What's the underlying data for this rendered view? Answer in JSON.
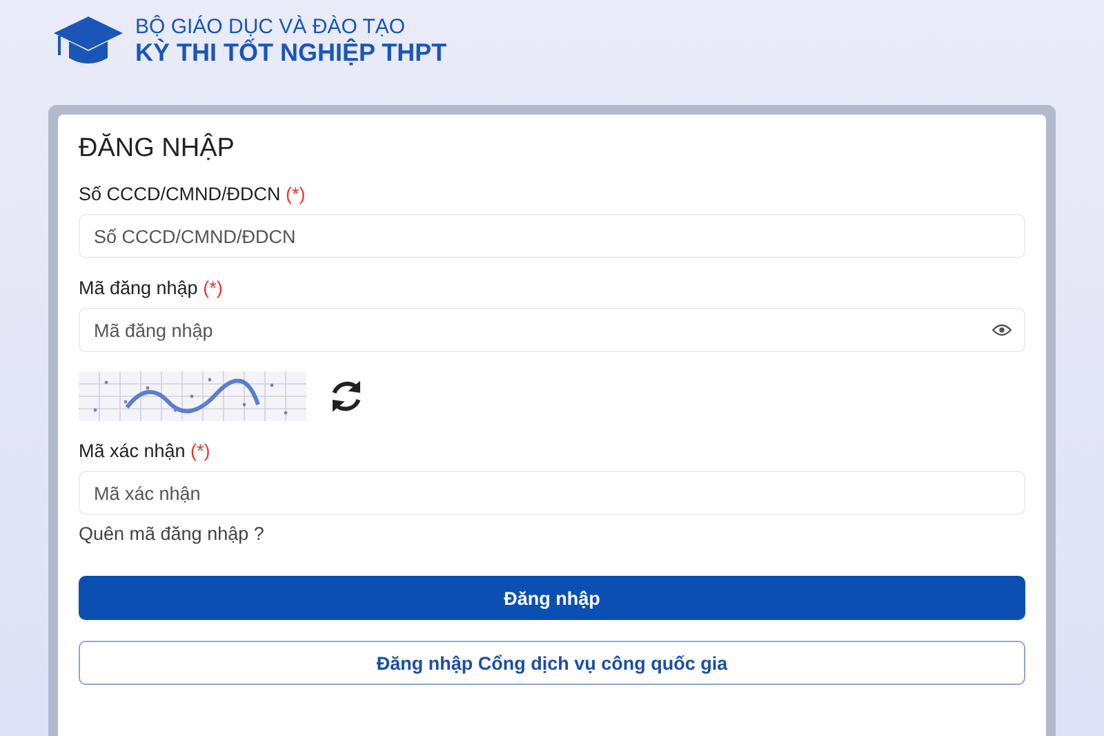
{
  "header": {
    "org": "BỘ GIÁO DỤC VÀ ĐÀO TẠO",
    "title": "KỲ THI TỐT NGHIỆP THPT"
  },
  "form": {
    "title": "ĐĂNG NHẬP",
    "fields": [
      {
        "kind": "text",
        "label": "Số CCCD/CMND/ĐDCN",
        "required_mark": "(*)",
        "placeholder": "Số CCCD/CMND/ĐDCN"
      },
      {
        "kind": "password",
        "label": "Mã đăng nhập",
        "required_mark": "(*)",
        "placeholder": "Mã đăng nhập"
      },
      {
        "kind": "captcha",
        "label": "Mã xác nhận",
        "required_mark": "(*)",
        "placeholder": "Mã xác nhận"
      }
    ],
    "forgot_link": "Quên mã đăng nhập ?",
    "buttons": [
      {
        "kind": "primary",
        "label": "Đăng nhập"
      },
      {
        "kind": "outline",
        "label": "Đăng nhập Cổng dịch vụ công quốc gia"
      }
    ]
  }
}
